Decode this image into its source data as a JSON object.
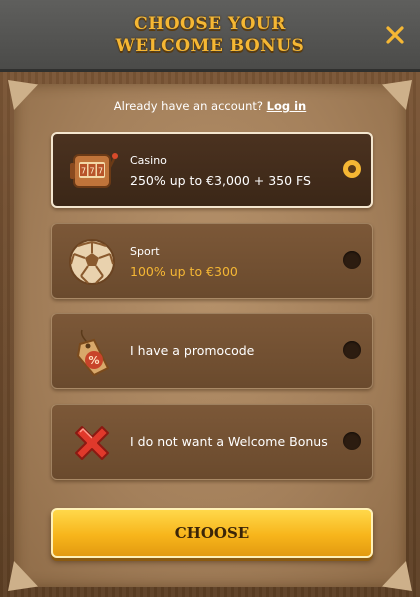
{
  "header": {
    "title_line1": "CHOOSE YOUR",
    "title_line2": "WELCOME BONUS"
  },
  "login": {
    "prompt": "Already have an account?",
    "link": "Log in"
  },
  "options": [
    {
      "icon": "slot-machine-icon",
      "small_label": "Casino",
      "main_label": "250% up to €3,000 + 350 FS",
      "selected": true
    },
    {
      "icon": "soccer-ball-icon",
      "small_label": "Sport",
      "main_label": "100% up to €300",
      "selected": false
    },
    {
      "icon": "price-tag-icon",
      "main_label": "I have a promocode",
      "selected": false
    },
    {
      "icon": "red-cross-icon",
      "main_label": "I do not want a Welcome Bonus",
      "selected": false
    }
  ],
  "choose_button": {
    "label": "CHOOSE"
  },
  "colors": {
    "accent_gold": "#f5b734",
    "header_bg": "#555553",
    "wood": "#6a4a2e",
    "parchment": "#a4805b"
  }
}
